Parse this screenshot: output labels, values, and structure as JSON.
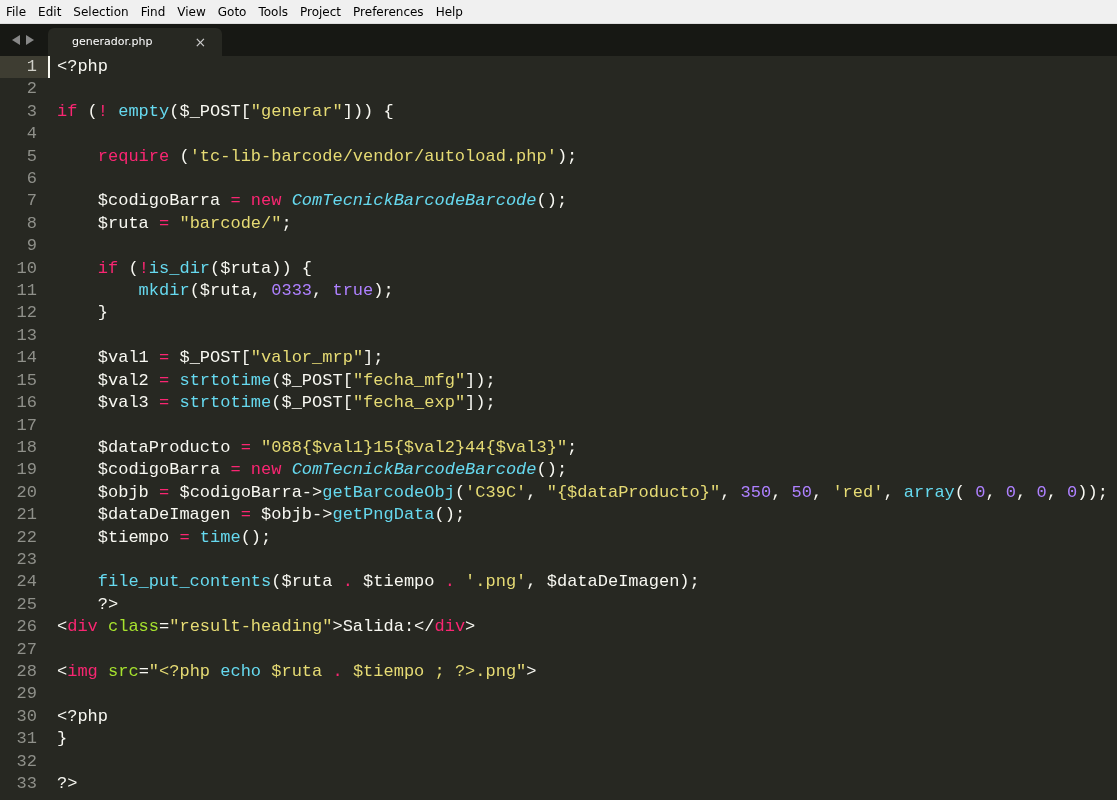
{
  "menu": [
    {
      "label": "File"
    },
    {
      "label": "Edit"
    },
    {
      "label": "Selection"
    },
    {
      "label": "Find"
    },
    {
      "label": "View"
    },
    {
      "label": "Goto"
    },
    {
      "label": "Tools"
    },
    {
      "label": "Project"
    },
    {
      "label": "Preferences"
    },
    {
      "label": "Help"
    }
  ],
  "tabs": [
    {
      "title": "generador.php",
      "close": "×",
      "selected": true
    }
  ],
  "lines": [
    {
      "number": "1",
      "current": true,
      "tokens": [
        {
          "kind": "plain",
          "text": "<?php"
        }
      ]
    },
    {
      "number": "2",
      "current": false
    },
    {
      "number": "3",
      "current": false,
      "tokens": [
        {
          "kind": "keyword",
          "text": "if"
        },
        {
          "kind": "plain",
          "text": " ("
        },
        {
          "kind": "keyword",
          "text": "!"
        },
        {
          "kind": "function",
          "text": " empty"
        },
        {
          "kind": "plain",
          "text": "($_POST["
        },
        {
          "kind": "string",
          "text": "\"generar\""
        },
        {
          "kind": "plain",
          "text": "])) {"
        }
      ]
    },
    {
      "number": "4",
      "current": false
    },
    {
      "number": "5",
      "current": false,
      "tokens": [
        {
          "kind": "keyword",
          "text": "    require"
        },
        {
          "kind": "plain",
          "text": " ("
        },
        {
          "kind": "string",
          "text": "'tc-lib-barcode/vendor/autoload.php'"
        },
        {
          "kind": "plain",
          "text": ");"
        }
      ]
    },
    {
      "number": "6",
      "current": false
    },
    {
      "number": "7",
      "current": false,
      "tokens": [
        {
          "kind": "plain",
          "text": "    $codigoBarra "
        },
        {
          "kind": "keyword",
          "text": "="
        },
        {
          "kind": "keyword",
          "text": " new"
        },
        {
          "kind": "class",
          "text": " ComTecnickBarcodeBarcode"
        },
        {
          "kind": "plain",
          "text": "();"
        }
      ]
    },
    {
      "number": "8",
      "current": false,
      "tokens": [
        {
          "kind": "plain",
          "text": "    $ruta "
        },
        {
          "kind": "keyword",
          "text": "="
        },
        {
          "kind": "string",
          "text": " \"barcode/\""
        },
        {
          "kind": "plain",
          "text": ";"
        }
      ]
    },
    {
      "number": "9",
      "current": false
    },
    {
      "number": "10",
      "current": false,
      "tokens": [
        {
          "kind": "keyword",
          "text": "    if"
        },
        {
          "kind": "plain",
          "text": " ("
        },
        {
          "kind": "keyword",
          "text": "!"
        },
        {
          "kind": "function",
          "text": "is_dir"
        },
        {
          "kind": "plain",
          "text": "($ruta)) {"
        }
      ]
    },
    {
      "number": "11",
      "current": false,
      "tokens": [
        {
          "kind": "function",
          "text": "        mkdir"
        },
        {
          "kind": "plain",
          "text": "($ruta, "
        },
        {
          "kind": "number",
          "text": "0333"
        },
        {
          "kind": "plain",
          "text": ", "
        },
        {
          "kind": "number",
          "text": "true"
        },
        {
          "kind": "plain",
          "text": ");"
        }
      ]
    },
    {
      "number": "12",
      "current": false,
      "tokens": [
        {
          "kind": "plain",
          "text": "    }"
        }
      ]
    },
    {
      "number": "13",
      "current": false
    },
    {
      "number": "14",
      "current": false,
      "tokens": [
        {
          "kind": "plain",
          "text": "    $val1 "
        },
        {
          "kind": "keyword",
          "text": "="
        },
        {
          "kind": "plain",
          "text": " $_POST["
        },
        {
          "kind": "string",
          "text": "\"valor_mrp\""
        },
        {
          "kind": "plain",
          "text": "];"
        }
      ]
    },
    {
      "number": "15",
      "current": false,
      "tokens": [
        {
          "kind": "plain",
          "text": "    $val2 "
        },
        {
          "kind": "keyword",
          "text": "="
        },
        {
          "kind": "function",
          "text": " strtotime"
        },
        {
          "kind": "plain",
          "text": "($_POST["
        },
        {
          "kind": "string",
          "text": "\"fecha_mfg\""
        },
        {
          "kind": "plain",
          "text": "]);"
        }
      ]
    },
    {
      "number": "16",
      "current": false,
      "tokens": [
        {
          "kind": "plain",
          "text": "    $val3 "
        },
        {
          "kind": "keyword",
          "text": "="
        },
        {
          "kind": "function",
          "text": " strtotime"
        },
        {
          "kind": "plain",
          "text": "($_POST["
        },
        {
          "kind": "string",
          "text": "\"fecha_exp\""
        },
        {
          "kind": "plain",
          "text": "]);"
        }
      ]
    },
    {
      "number": "17",
      "current": false
    },
    {
      "number": "18",
      "current": false,
      "tokens": [
        {
          "kind": "plain",
          "text": "    $dataProducto "
        },
        {
          "kind": "keyword",
          "text": "="
        },
        {
          "kind": "string",
          "text": " \"088{$val1}15{$val2}44{$val3}\""
        },
        {
          "kind": "plain",
          "text": ";"
        }
      ]
    },
    {
      "number": "19",
      "current": false,
      "tokens": [
        {
          "kind": "plain",
          "text": "    $codigoBarra "
        },
        {
          "kind": "keyword",
          "text": "="
        },
        {
          "kind": "keyword",
          "text": " new"
        },
        {
          "kind": "class",
          "text": " ComTecnickBarcodeBarcode"
        },
        {
          "kind": "plain",
          "text": "();"
        }
      ]
    },
    {
      "number": "20",
      "current": false,
      "tokens": [
        {
          "kind": "plain",
          "text": "    $objb "
        },
        {
          "kind": "keyword",
          "text": "="
        },
        {
          "kind": "plain",
          "text": " $codigoBarra->"
        },
        {
          "kind": "function",
          "text": "getBarcodeObj"
        },
        {
          "kind": "plain",
          "text": "("
        },
        {
          "kind": "string",
          "text": "'C39C'"
        },
        {
          "kind": "plain",
          "text": ","
        },
        {
          "kind": "string",
          "text": " \"{$dataProducto}\""
        },
        {
          "kind": "plain",
          "text": ","
        },
        {
          "kind": "number",
          "text": " 350"
        },
        {
          "kind": "plain",
          "text": ","
        },
        {
          "kind": "number",
          "text": " 50"
        },
        {
          "kind": "plain",
          "text": ","
        },
        {
          "kind": "string",
          "text": " 'red'"
        },
        {
          "kind": "plain",
          "text": ","
        },
        {
          "kind": "function",
          "text": " array"
        },
        {
          "kind": "plain",
          "text": "("
        },
        {
          "kind": "number",
          "text": " 0"
        },
        {
          "kind": "plain",
          "text": ","
        },
        {
          "kind": "number",
          "text": " 0"
        },
        {
          "kind": "plain",
          "text": ","
        },
        {
          "kind": "number",
          "text": " 0"
        },
        {
          "kind": "plain",
          "text": ","
        },
        {
          "kind": "number",
          "text": " 0"
        },
        {
          "kind": "plain",
          "text": "));"
        }
      ]
    },
    {
      "number": "21",
      "current": false,
      "tokens": [
        {
          "kind": "plain",
          "text": "    $dataDeImagen "
        },
        {
          "kind": "keyword",
          "text": "="
        },
        {
          "kind": "plain",
          "text": " $objb->"
        },
        {
          "kind": "function",
          "text": "getPngData"
        },
        {
          "kind": "plain",
          "text": "();"
        }
      ]
    },
    {
      "number": "22",
      "current": false,
      "tokens": [
        {
          "kind": "plain",
          "text": "    $tiempo "
        },
        {
          "kind": "keyword",
          "text": "="
        },
        {
          "kind": "function",
          "text": " time"
        },
        {
          "kind": "plain",
          "text": "();"
        }
      ]
    },
    {
      "number": "23",
      "current": false
    },
    {
      "number": "24",
      "current": false,
      "tokens": [
        {
          "kind": "function",
          "text": "    file_put_contents"
        },
        {
          "kind": "plain",
          "text": "($ruta "
        },
        {
          "kind": "keyword",
          "text": "."
        },
        {
          "kind": "plain",
          "text": " $tiempo "
        },
        {
          "kind": "keyword",
          "text": "."
        },
        {
          "kind": "string",
          "text": " '.png'"
        },
        {
          "kind": "plain",
          "text": ", $dataDeImagen);"
        }
      ]
    },
    {
      "number": "25",
      "current": false,
      "tokens": [
        {
          "kind": "plain",
          "text": "    ?>"
        }
      ]
    },
    {
      "number": "26",
      "current": false,
      "tokens": [
        {
          "kind": "plain",
          "text": "<"
        },
        {
          "kind": "keyword",
          "text": "div"
        },
        {
          "kind": "attribute",
          "text": " class"
        },
        {
          "kind": "plain",
          "text": "="
        },
        {
          "kind": "string",
          "text": "\"result-heading\""
        },
        {
          "kind": "plain",
          "text": ">Salida:</"
        },
        {
          "kind": "keyword",
          "text": "div"
        },
        {
          "kind": "plain",
          "text": ">"
        }
      ]
    },
    {
      "number": "27",
      "current": false
    },
    {
      "number": "28",
      "current": false,
      "tokens": [
        {
          "kind": "plain",
          "text": "<"
        },
        {
          "kind": "keyword",
          "text": "img"
        },
        {
          "kind": "attribute",
          "text": " src"
        },
        {
          "kind": "plain",
          "text": "="
        },
        {
          "kind": "string",
          "text": "\"<?php "
        },
        {
          "kind": "function",
          "text": "echo"
        },
        {
          "kind": "string",
          "text": " $ruta "
        },
        {
          "kind": "keyword",
          "text": "."
        },
        {
          "kind": "string",
          "text": " $tiempo ; ?>.png\""
        },
        {
          "kind": "plain",
          "text": ">"
        }
      ]
    },
    {
      "number": "29",
      "current": false
    },
    {
      "number": "30",
      "current": false,
      "tokens": [
        {
          "kind": "plain",
          "text": "<?php"
        }
      ]
    },
    {
      "number": "31",
      "current": false,
      "tokens": [
        {
          "kind": "plain",
          "text": "}"
        }
      ]
    },
    {
      "number": "32",
      "current": false
    },
    {
      "number": "33",
      "current": false,
      "tokens": [
        {
          "kind": "plain",
          "text": "?>"
        }
      ]
    }
  ]
}
